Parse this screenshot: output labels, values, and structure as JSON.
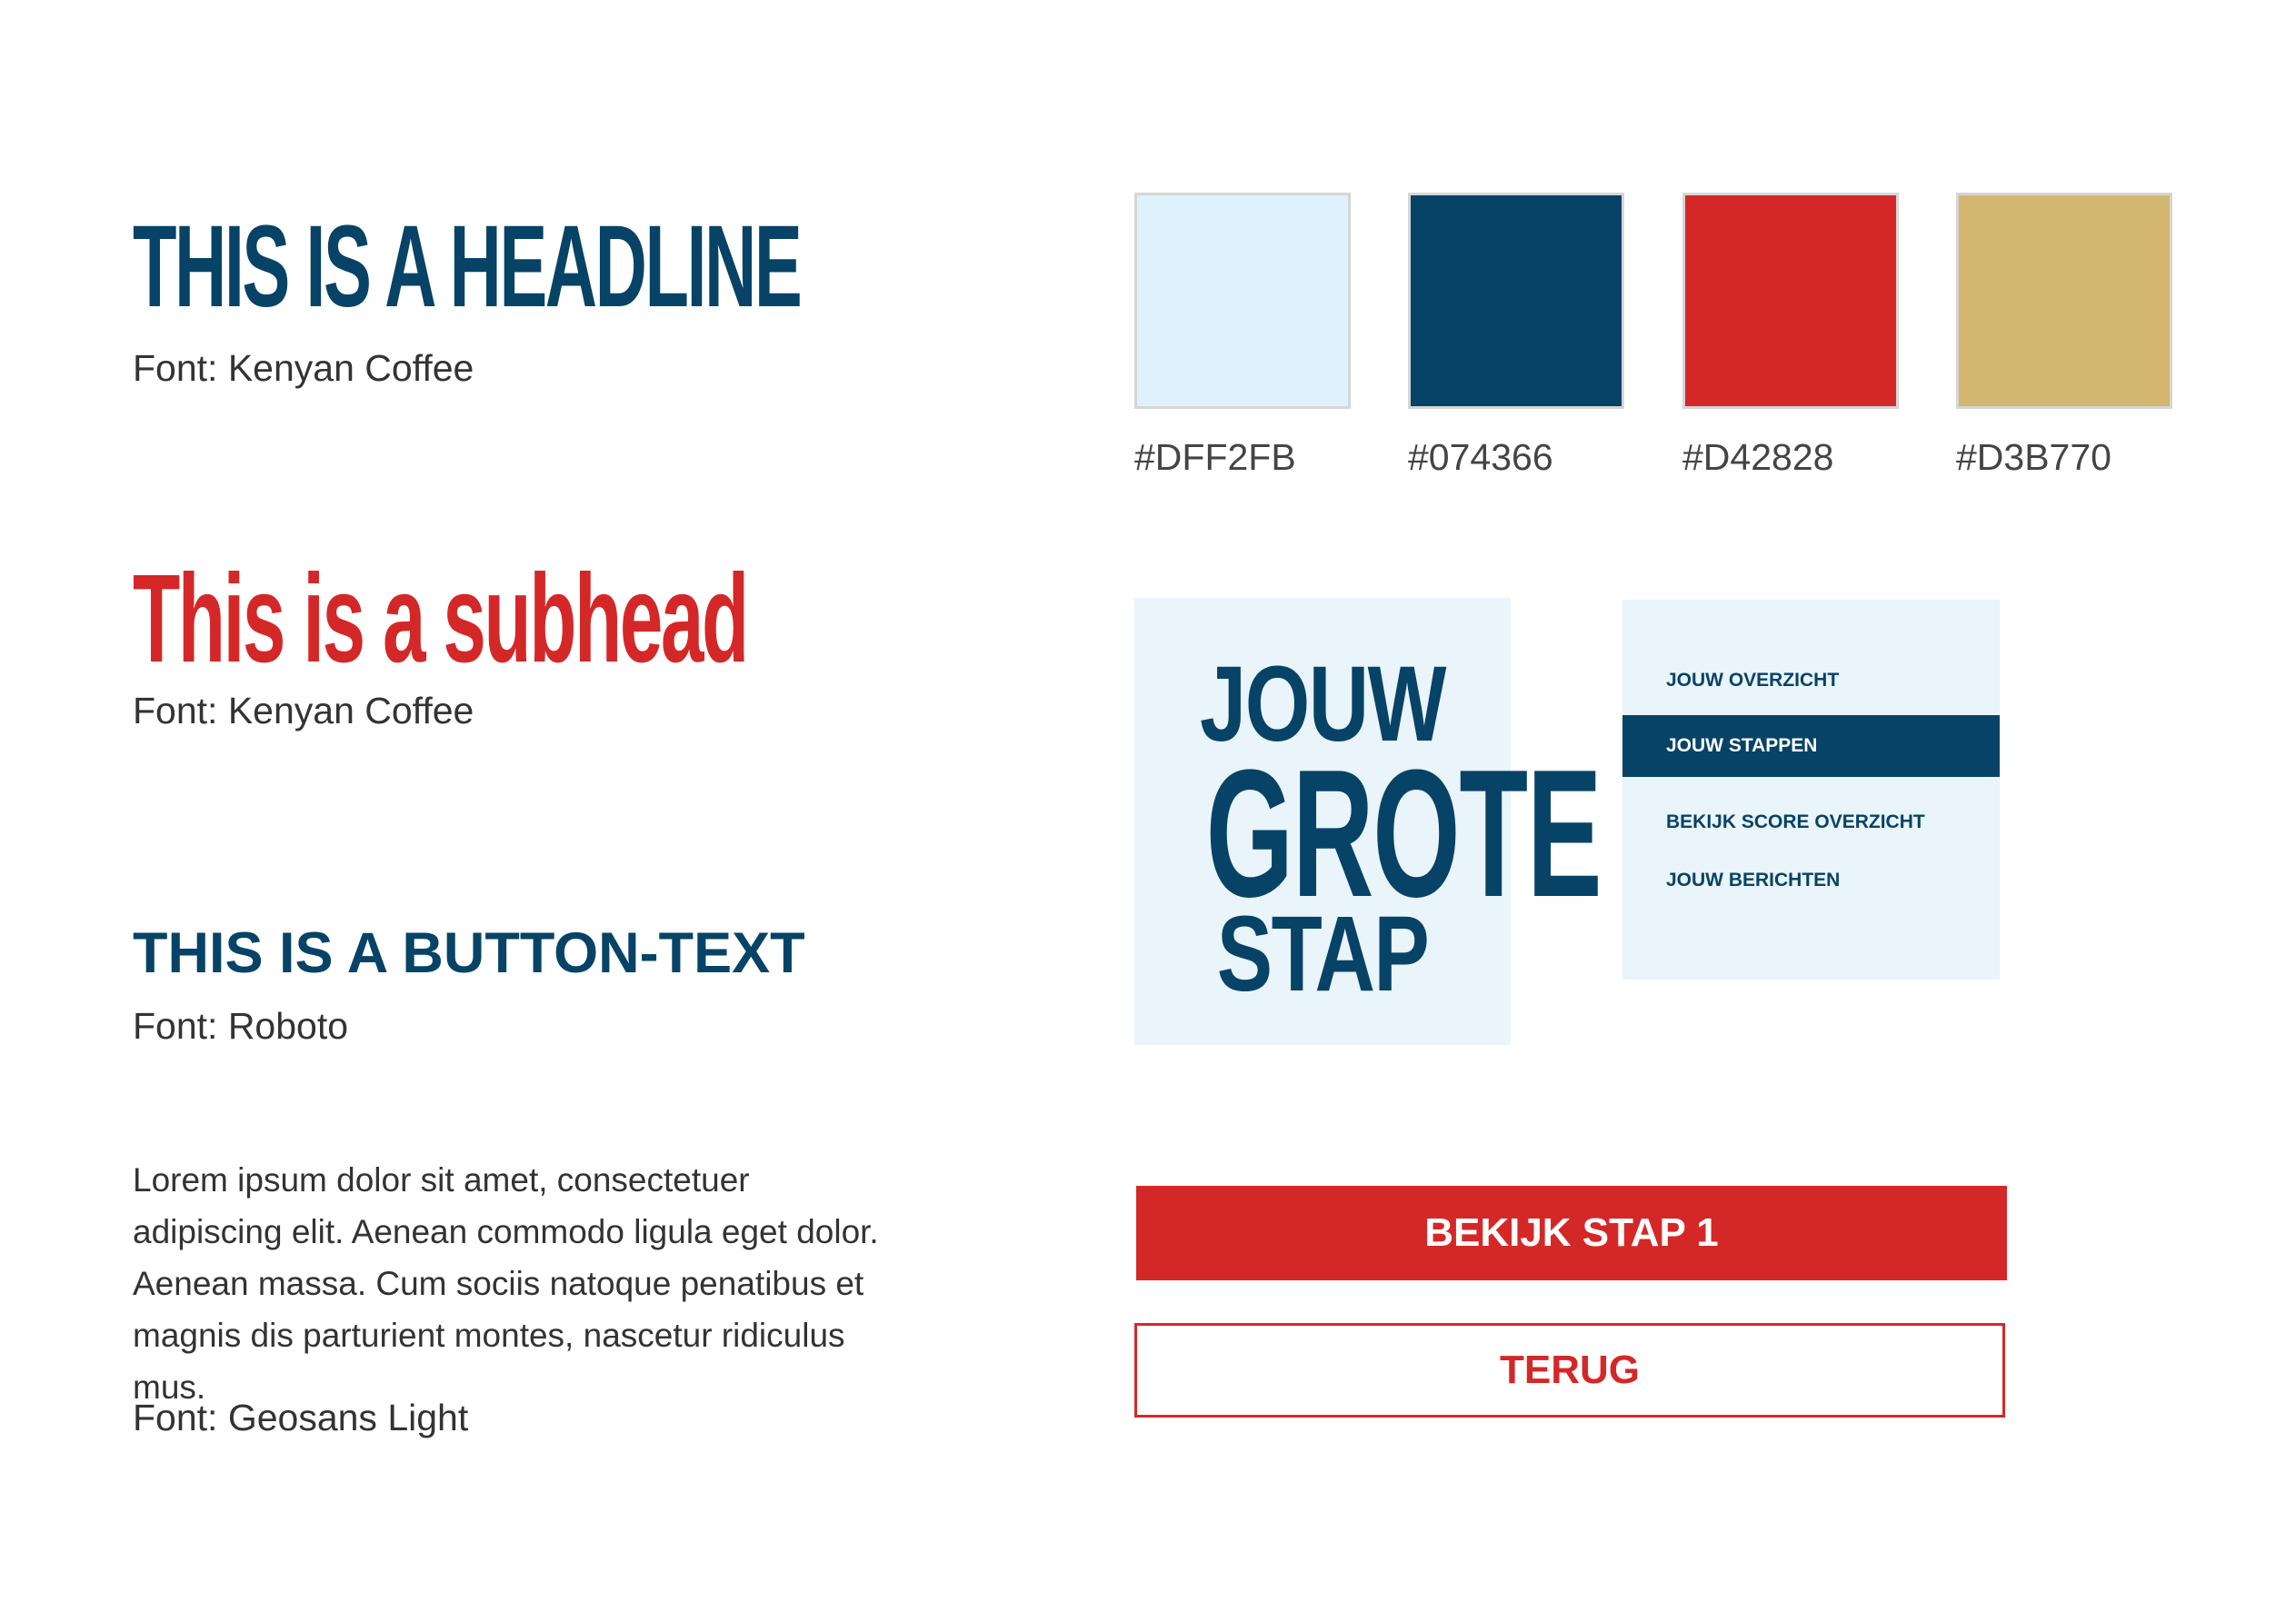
{
  "typography": {
    "headline": {
      "text": "THIS IS A HEADLINE",
      "font_label": "Font: Kenyan Coffee"
    },
    "subhead": {
      "text": "This is a subhead",
      "font_label": "Font: Kenyan Coffee"
    },
    "button_text": {
      "text": "THIS IS A BUTTON-TEXT",
      "font_label": "Font: Roboto"
    },
    "body": {
      "text": "Lorem ipsum dolor sit amet, consectetuer adipiscing elit. Aenean commodo ligula eget dolor. Aenean massa. Cum sociis natoque penatibus et magnis dis parturient montes, nascetur ridiculus mus.",
      "font_label": "Font: Geosans Light"
    }
  },
  "palette": [
    {
      "hex": "#DFF2FB",
      "label": "#DFF2FB"
    },
    {
      "hex": "#074366",
      "label": "#074366"
    },
    {
      "hex": "#D42828",
      "label": "#D42828"
    },
    {
      "hex": "#D3B770",
      "label": "#D3B770"
    }
  ],
  "logo": {
    "lines": [
      "JOUW",
      "GROTE",
      "STAP"
    ]
  },
  "menu": {
    "items": [
      {
        "label": "JOUW OVERZICHT",
        "active": false
      },
      {
        "label": "JOUW STAPPEN",
        "active": true
      },
      {
        "label": "BEKIJK SCORE OVERZICHT",
        "active": false
      },
      {
        "label": "JOUW BERICHTEN",
        "active": false
      }
    ]
  },
  "buttons": {
    "primary_label": "BEKIJK STAP 1",
    "secondary_label": "TERUG"
  },
  "colors": {
    "primary_blue": "#074366",
    "primary_red": "#D42828",
    "light_blue": "#DFF2FB",
    "gold": "#D3B770"
  }
}
